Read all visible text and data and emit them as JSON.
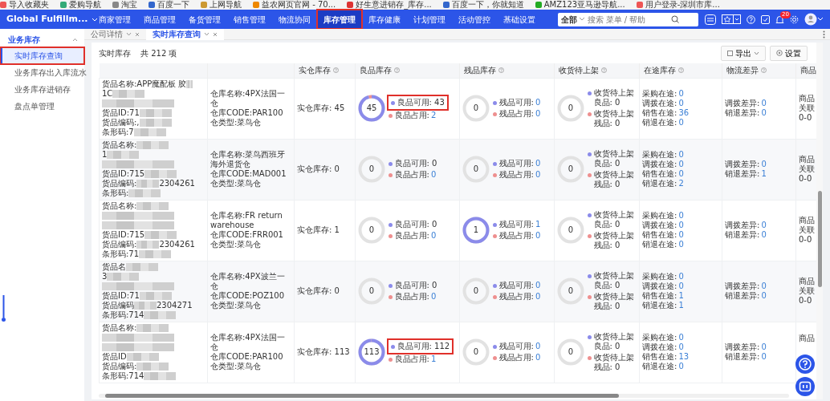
{
  "bookmarks": [
    "导入收藏夹",
    "爱购导航",
    "淘宝",
    "百度一下",
    "上网导航",
    "益农网页官网 - 70...",
    "好生意进销存_库存...",
    "百度一下，你就知道",
    "AMZ123亚马逊导航...",
    "用户登录-深圳市库..."
  ],
  "app": {
    "brand": "Global Fulfillm..."
  },
  "nav": [
    {
      "label": "商家管理",
      "selected": false,
      "annotated": false
    },
    {
      "label": "商品管理",
      "selected": false,
      "annotated": false
    },
    {
      "label": "备货管理",
      "selected": false,
      "annotated": false
    },
    {
      "label": "销售管理",
      "selected": false,
      "annotated": false
    },
    {
      "label": "物流协同",
      "selected": false,
      "annotated": false
    },
    {
      "label": "库存管理",
      "selected": true,
      "annotated": true
    },
    {
      "label": "库存健康",
      "selected": false,
      "annotated": false
    },
    {
      "label": "计划管理",
      "selected": false,
      "annotated": false
    },
    {
      "label": "活动管控",
      "selected": false,
      "annotated": false
    },
    {
      "label": "基础设置",
      "selected": false,
      "annotated": false
    }
  ],
  "search": {
    "scope": "全部",
    "placeholder": "搜索 菜单 / 帮助"
  },
  "notifications": {
    "count": "20"
  },
  "sidebar": {
    "group": "业务库存",
    "expanded": true,
    "items": [
      {
        "label": "实时库存查询",
        "selected": true,
        "annotated": true
      },
      {
        "label": "业务库存出入库流水",
        "selected": false,
        "annotated": false
      },
      {
        "label": "业务库存进销存",
        "selected": false,
        "annotated": false
      },
      {
        "label": "盘点单管理",
        "selected": false,
        "annotated": false
      }
    ]
  },
  "tabs": [
    {
      "label": "公司详情",
      "selected": false
    },
    {
      "label": "实时库存查询",
      "selected": true
    }
  ],
  "page": {
    "title": "实时库存",
    "count": "共 212 项",
    "buttons": [
      {
        "label": "导出",
        "kind": "export"
      },
      {
        "label": "设置",
        "kind": "settings"
      }
    ]
  },
  "table": {
    "columns": [
      {
        "label": "实仓库存",
        "help": true
      },
      {
        "label": "良品库存",
        "help": true
      },
      {
        "label": "残品库存",
        "help": true
      },
      {
        "label": "收货待上架",
        "help": true
      },
      {
        "label": "在途库存",
        "help": true
      },
      {
        "label": "物流差异",
        "help": true
      },
      {
        "label": "商品",
        "help": false
      }
    ],
    "rows": [
      {
        "product": [
          {
            "text": "货品名称:APP魔配板 胶",
            "masked": true
          },
          {
            "text": "1C",
            "masked": true
          },
          {
            "masked": true
          },
          {
            "text": "货品ID:71",
            "masked": true
          },
          {
            "text": "货品编码:,",
            "masked": true
          },
          {
            "text": "条形码:7",
            "masked": true
          }
        ],
        "warehouse": [
          "仓库名称:4PX法国一仓",
          "仓库CODE:PAR100",
          "仓类型:菜鸟仓"
        ],
        "physical": "实仓库存: 45",
        "good": {
          "total": "45",
          "items": [
            {
              "label": "良品可用:",
              "value": "43",
              "color": "#8b8bea",
              "link": false,
              "annotated": true
            },
            {
              "label": "良品占用:",
              "value": "2",
              "color": "#ee8f8f",
              "link": true,
              "annotated": false
            }
          ]
        },
        "defective": {
          "total": "0",
          "items": [
            {
              "label": "残品可用:",
              "value": "0",
              "color": "#8b8bea",
              "link": true,
              "annotated": false
            },
            {
              "label": "残品占用:",
              "value": "0",
              "color": "#ee8f8f",
              "link": true,
              "annotated": false
            }
          ]
        },
        "receiving": {
          "total": "0",
          "items": [
            {
              "label": "收货待上架良品:",
              "value": "0",
              "color": "#8b8bea",
              "link": false,
              "annotated": false
            },
            {
              "label": "收货待上架残品:",
              "value": "0",
              "color": "#ee8f8f",
              "link": false,
              "annotated": false
            }
          ]
        },
        "in_transit": [
          {
            "label": "采购在途:",
            "value": "0"
          },
          {
            "label": "调拨在途:",
            "value": "0"
          },
          {
            "label": "销售在途:",
            "value": "36"
          },
          {
            "label": "销退在途:",
            "value": "0"
          }
        ],
        "logistics_diff": [
          {
            "label": "调拨差异:",
            "value": "0"
          },
          {
            "label": "销退差异:",
            "value": "0"
          }
        ],
        "column_9": [
          "商品",
          "关联",
          "0-0"
        ]
      },
      {
        "product": [
          {
            "text": "货品名称:",
            "masked": true
          },
          {
            "text": "1",
            "masked": true
          },
          {
            "masked": true
          },
          {
            "text": "货品ID:715",
            "masked": true
          },
          {
            "text": "货品编码:",
            "masked": true,
            "tail": "2304261"
          },
          {
            "text": "条形码:",
            "masked": true
          }
        ],
        "warehouse": [
          "仓库名称:菜鸟西班牙海外退货仓",
          "仓库CODE:MAD001",
          "仓类型:菜鸟仓"
        ],
        "physical": "实仓库存: 0",
        "good": {
          "total": "0",
          "items": [
            {
              "label": "良品可用:",
              "value": "0",
              "color": "#8b8bea",
              "link": false,
              "annotated": false
            },
            {
              "label": "良品占用:",
              "value": "0",
              "color": "#ee8f8f",
              "link": true,
              "annotated": false
            }
          ]
        },
        "defective": {
          "total": "0",
          "items": [
            {
              "label": "残品可用:",
              "value": "0",
              "color": "#8b8bea",
              "link": true,
              "annotated": false
            },
            {
              "label": "残品占用:",
              "value": "0",
              "color": "#ee8f8f",
              "link": true,
              "annotated": false
            }
          ]
        },
        "receiving": {
          "total": "0",
          "items": [
            {
              "label": "收货待上架良品:",
              "value": "0",
              "color": "#8b8bea",
              "link": false,
              "annotated": false
            },
            {
              "label": "收货待上架残品:",
              "value": "0",
              "color": "#ee8f8f",
              "link": false,
              "annotated": false
            }
          ]
        },
        "in_transit": [
          {
            "label": "采购在途:",
            "value": "0"
          },
          {
            "label": "调拨在途:",
            "value": "0"
          },
          {
            "label": "销售在途:",
            "value": "0"
          },
          {
            "label": "销退在途:",
            "value": "2"
          }
        ],
        "logistics_diff": [
          {
            "label": "调拨差异:",
            "value": "0"
          },
          {
            "label": "销退差异:",
            "value": "1"
          }
        ],
        "column_9": [
          "商品",
          "关联",
          "0-0"
        ]
      },
      {
        "product": [
          {
            "text": "货品名称:",
            "masked": true
          },
          {
            "masked": true
          },
          {
            "masked": true
          },
          {
            "text": "货品ID:715",
            "masked": true
          },
          {
            "text": "货品编码:",
            "masked": true,
            "tail": "2304261"
          },
          {
            "text": "条形码:71",
            "masked": true
          }
        ],
        "warehouse": [
          "仓库名称:FR return warehouse",
          "仓库CODE:FRR001",
          "仓类型:菜鸟仓"
        ],
        "physical": "实仓库存: 1",
        "good": {
          "total": "0",
          "items": [
            {
              "label": "良品可用:",
              "value": "0",
              "color": "#8b8bea",
              "link": false,
              "annotated": false
            },
            {
              "label": "良品占用:",
              "value": "0",
              "color": "#ee8f8f",
              "link": true,
              "annotated": false
            }
          ]
        },
        "defective": {
          "total": "1",
          "items": [
            {
              "label": "残品可用:",
              "value": "1",
              "color": "#8b8bea",
              "link": true,
              "annotated": false
            },
            {
              "label": "残品占用:",
              "value": "0",
              "color": "#ee8f8f",
              "link": true,
              "annotated": false
            }
          ]
        },
        "receiving": {
          "total": "0",
          "items": [
            {
              "label": "收货待上架良品:",
              "value": "0",
              "color": "#8b8bea",
              "link": false,
              "annotated": false
            },
            {
              "label": "收货待上架残品:",
              "value": "0",
              "color": "#ee8f8f",
              "link": false,
              "annotated": false
            }
          ]
        },
        "in_transit": [
          {
            "label": "采购在途:",
            "value": "0"
          },
          {
            "label": "调拨在途:",
            "value": "0"
          },
          {
            "label": "销售在途:",
            "value": "0"
          },
          {
            "label": "销退在途:",
            "value": "0"
          }
        ],
        "logistics_diff": [
          {
            "label": "调拨差异:",
            "value": "0"
          },
          {
            "label": "销退差异:",
            "value": "0"
          }
        ],
        "column_9": [
          "商品",
          "关联",
          "0-0"
        ]
      },
      {
        "product": [
          {
            "text": "货品名",
            "masked": true
          },
          {
            "text": "3",
            "masked": true
          },
          {
            "masked": true
          },
          {
            "text": "货品ID:71",
            "masked": true
          },
          {
            "text": "货品编码",
            "masked": true,
            "tail": "2304271"
          },
          {
            "text": "条形码:714",
            "masked": true
          }
        ],
        "warehouse": [
          "仓库名称:4PX波兰一仓",
          "仓库CODE:POZ100",
          "仓类型:菜鸟仓"
        ],
        "physical": "实仓库存: 0",
        "good": {
          "total": "0",
          "items": [
            {
              "label": "良品可用:",
              "value": "0",
              "color": "#8b8bea",
              "link": false,
              "annotated": false
            },
            {
              "label": "良品占用:",
              "value": "0",
              "color": "#ee8f8f",
              "link": true,
              "annotated": false
            }
          ]
        },
        "defective": {
          "total": "0",
          "items": [
            {
              "label": "残品可用:",
              "value": "0",
              "color": "#8b8bea",
              "link": true,
              "annotated": false
            },
            {
              "label": "残品占用:",
              "value": "0",
              "color": "#ee8f8f",
              "link": true,
              "annotated": false
            }
          ]
        },
        "receiving": {
          "total": "0",
          "items": [
            {
              "label": "收货待上架良品:",
              "value": "0",
              "color": "#8b8bea",
              "link": false,
              "annotated": false
            },
            {
              "label": "收货待上架残品:",
              "value": "0",
              "color": "#ee8f8f",
              "link": false,
              "annotated": false
            }
          ]
        },
        "in_transit": [
          {
            "label": "采购在途:",
            "value": "0"
          },
          {
            "label": "调拨在途:",
            "value": "0"
          },
          {
            "label": "销售在途:",
            "value": "1"
          },
          {
            "label": "销退在途:",
            "value": "1"
          }
        ],
        "logistics_diff": [
          {
            "label": "调拨差异:",
            "value": "0"
          },
          {
            "label": "销退差异:",
            "value": "0"
          }
        ],
        "column_9": [
          "商品",
          "关联",
          "0-0"
        ]
      },
      {
        "product": [
          {
            "text": "货品名称:",
            "masked": true
          },
          {
            "masked": true
          },
          {
            "masked": true
          },
          {
            "text": "货品ID",
            "masked": true
          },
          {
            "text": "货品编码:",
            "masked": true
          },
          {
            "text": "条形码:714",
            "masked": true
          }
        ],
        "warehouse": [
          "仓库名称:4PX法国一仓",
          "仓库CODE:PAR100",
          "仓类型:菜鸟仓"
        ],
        "physical": "实仓库存: 113",
        "good": {
          "total": "113",
          "items": [
            {
              "label": "良品可用:",
              "value": "112",
              "color": "#8b8bea",
              "link": false,
              "annotated": true
            },
            {
              "label": "良品占用:",
              "value": "1",
              "color": "#ee8f8f",
              "link": true,
              "annotated": false
            }
          ]
        },
        "defective": {
          "total": "0",
          "items": [
            {
              "label": "残品可用:",
              "value": "0",
              "color": "#8b8bea",
              "link": true,
              "annotated": false
            },
            {
              "label": "残品占用:",
              "value": "0",
              "color": "#ee8f8f",
              "link": true,
              "annotated": false
            }
          ]
        },
        "receiving": {
          "total": "0",
          "items": [
            {
              "label": "收货待上架良品:",
              "value": "0",
              "color": "#8b8bea",
              "link": false,
              "annotated": false
            },
            {
              "label": "收货待上架残品:",
              "value": "0",
              "color": "#ee8f8f",
              "link": false,
              "annotated": false
            }
          ]
        },
        "in_transit": [
          {
            "label": "采购在途:",
            "value": "0"
          },
          {
            "label": "调拨在途:",
            "value": "0"
          },
          {
            "label": "销售在途:",
            "value": "13"
          },
          {
            "label": "销退在途:",
            "value": "0"
          }
        ],
        "logistics_diff": [
          {
            "label": "调拨差异:",
            "value": "0"
          },
          {
            "label": "销退差异:",
            "value": "0"
          }
        ],
        "column_9": [
          "商品"
        ]
      }
    ]
  }
}
